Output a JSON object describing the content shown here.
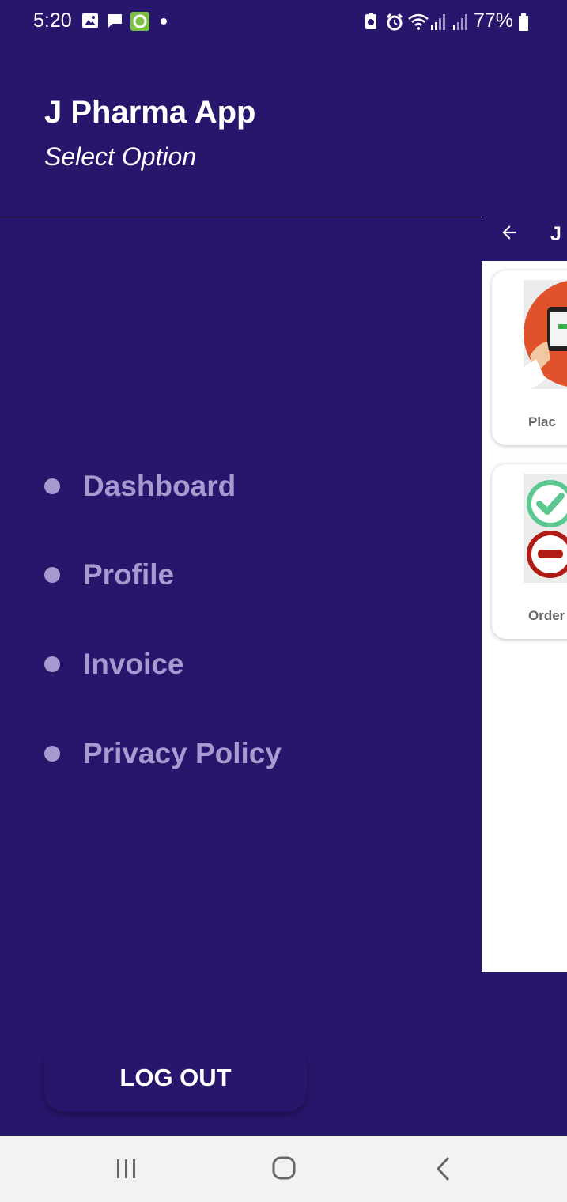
{
  "status_bar": {
    "time": "5:20",
    "battery": "77%"
  },
  "drawer": {
    "title": "J Pharma App",
    "subtitle": "Select Option",
    "menu_items": [
      {
        "label": "Dashboard"
      },
      {
        "label": "Profile"
      },
      {
        "label": "Invoice"
      },
      {
        "label": "Privacy Policy"
      }
    ],
    "logout_label": "LOG OUT"
  },
  "app_peek": {
    "toolbar_title": "J",
    "back_icon": "arrow-left-icon",
    "cards": [
      {
        "label": "Plac",
        "icon": "phone-order-icon"
      },
      {
        "label": "Order",
        "icon": "order-status-icon"
      }
    ]
  },
  "colors": {
    "primary": "#28166d",
    "menu_text": "#a79ad0",
    "nav_bar": "#f2f2f2"
  },
  "nav_bar": {
    "buttons": [
      "recent-apps-icon",
      "home-icon",
      "back-icon"
    ]
  }
}
